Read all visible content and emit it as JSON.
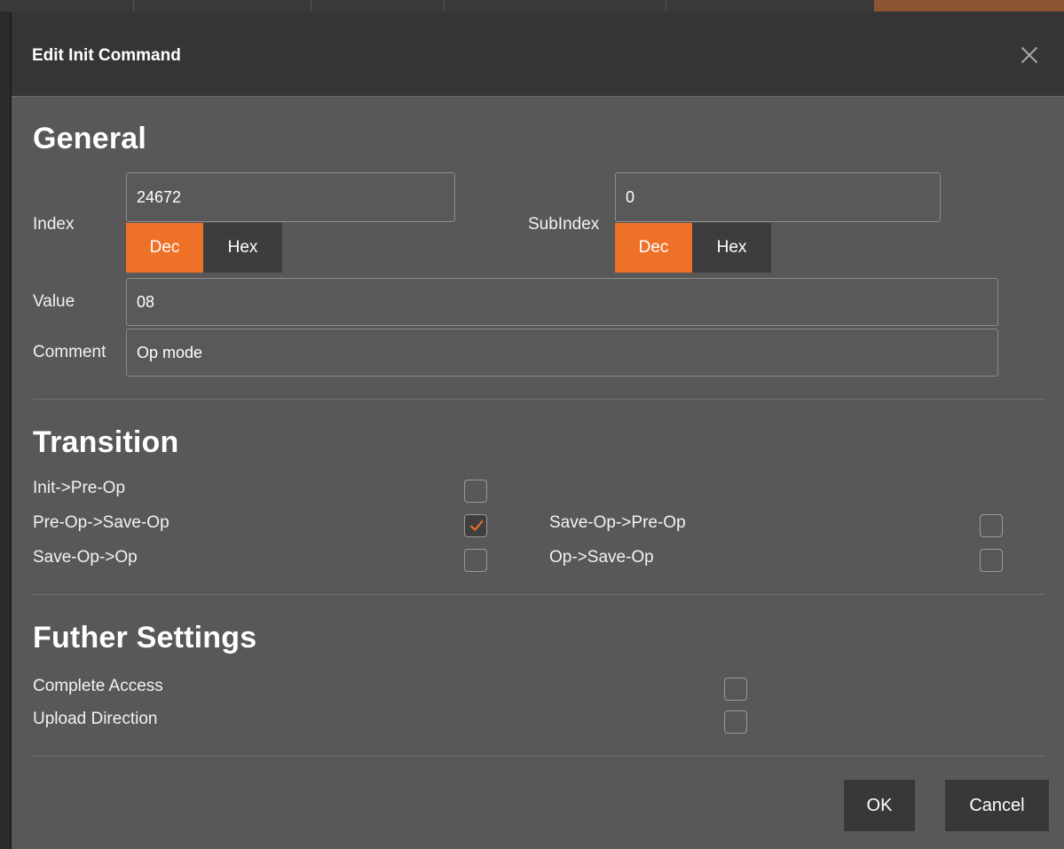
{
  "dialog": {
    "title": "Edit Init Command",
    "close_icon": "close-icon"
  },
  "general": {
    "heading": "General",
    "index": {
      "label": "Index",
      "value": "24672",
      "dec_label": "Dec",
      "hex_label": "Hex",
      "selected": "Dec"
    },
    "subindex": {
      "label": "SubIndex",
      "value": "0",
      "dec_label": "Dec",
      "hex_label": "Hex",
      "selected": "Dec"
    },
    "value": {
      "label": "Value",
      "value": "08"
    },
    "comment": {
      "label": "Comment",
      "value": "Op mode"
    }
  },
  "transition": {
    "heading": "Transition",
    "items": [
      {
        "label": "Init->Pre-Op",
        "checked": false
      },
      {
        "label": "Pre-Op->Save-Op",
        "checked": true
      },
      {
        "label": "Save-Op->Pre-Op",
        "checked": false
      },
      {
        "label": "Save-Op->Op",
        "checked": false
      },
      {
        "label": "Op->Save-Op",
        "checked": false
      }
    ]
  },
  "further": {
    "heading": "Futher Settings",
    "items": [
      {
        "label": "Complete Access",
        "checked": false
      },
      {
        "label": "Upload Direction",
        "checked": false
      }
    ]
  },
  "buttons": {
    "ok": "OK",
    "cancel": "Cancel"
  },
  "colors": {
    "accent": "#ee7128",
    "panel": "#585858",
    "titlebar": "#353535"
  }
}
